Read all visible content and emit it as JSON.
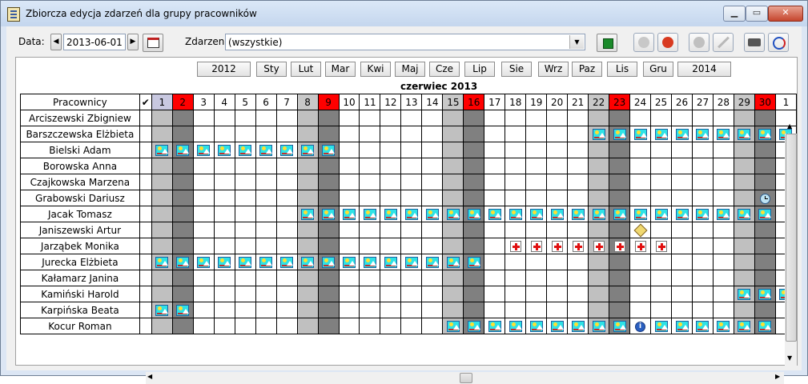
{
  "window": {
    "title": "Zbiorcza edycja zdarzeń dla grupy pracowników"
  },
  "toolbar": {
    "date_label": "Data:",
    "date_value": "2013-06-01",
    "event_label": "Zdarzenie:",
    "event_value": "(wszystkie)"
  },
  "months_nav": {
    "prev_year": "2012",
    "months": [
      "Sty",
      "Lut",
      "Mar",
      "Kwi",
      "Maj",
      "Cze",
      "Lip",
      "Sie",
      "Wrz",
      "Paz",
      "Lis",
      "Gru"
    ],
    "next_year": "2014"
  },
  "calendar": {
    "month_title": "czerwiec 2013",
    "name_header": "Pracownicy",
    "check_header": "✔",
    "days": [
      "1",
      "2",
      "3",
      "4",
      "5",
      "6",
      "7",
      "8",
      "9",
      "10",
      "11",
      "12",
      "13",
      "14",
      "15",
      "16",
      "17",
      "18",
      "19",
      "20",
      "21",
      "22",
      "23",
      "24",
      "25",
      "26",
      "27",
      "28",
      "29",
      "30",
      "1"
    ],
    "day_kinds": [
      "first",
      "hol",
      "",
      "",
      "",
      "",
      "",
      "we1",
      "hol",
      "",
      "",
      "",
      "",
      "",
      "we1",
      "hol",
      "",
      "",
      "",
      "",
      "",
      "we1",
      "hol",
      "",
      "",
      "",
      "",
      "",
      "we1",
      "hol",
      ""
    ],
    "col_kinds": [
      "we1",
      "we2",
      "",
      "",
      "",
      "",
      "",
      "we1",
      "we2",
      "",
      "",
      "",
      "",
      "",
      "we1",
      "we2",
      "",
      "",
      "",
      "",
      "",
      "we1",
      "we2",
      "",
      "",
      "",
      "",
      "",
      "we1",
      "we2",
      ""
    ],
    "employees": [
      {
        "name": "Arciszewski Zbigniew",
        "events": {}
      },
      {
        "name": "Barszczewska Elżbieta",
        "events": {
          "22": "vac",
          "23": "vac",
          "24": "vac",
          "25": "vac",
          "26": "vac",
          "27": "vac",
          "28": "vac",
          "29": "vac",
          "30": "vac",
          "31": "vac"
        }
      },
      {
        "name": "Bielski Adam",
        "events": {
          "1": "vac",
          "2": "vac",
          "3": "vac",
          "4": "vac",
          "5": "vac",
          "6": "vac",
          "7": "vac",
          "8": "vac",
          "9": "vac"
        }
      },
      {
        "name": "Borowska Anna",
        "events": {}
      },
      {
        "name": "Czajkowska Marzena",
        "events": {}
      },
      {
        "name": "Grabowski Dariusz",
        "events": {
          "30": "clock"
        }
      },
      {
        "name": "Jacak Tomasz",
        "events": {
          "8": "vac",
          "9": "vac",
          "10": "vac",
          "11": "vac",
          "12": "vac",
          "13": "vac",
          "14": "vac",
          "15": "vac",
          "16": "vac",
          "17": "vac",
          "18": "vac",
          "19": "vac",
          "20": "vac",
          "21": "vac",
          "22": "vac",
          "23": "vac",
          "24": "vac",
          "25": "vac",
          "26": "vac",
          "27": "vac",
          "28": "vac",
          "29": "vac",
          "30": "vac"
        }
      },
      {
        "name": "Janiszewski Artur",
        "events": {
          "24": "tag"
        }
      },
      {
        "name": "Jarząbek Monika",
        "events": {
          "18": "sick",
          "19": "sick",
          "20": "sick",
          "21": "sick",
          "22": "sick",
          "23": "sick",
          "24": "sick",
          "25": "sick"
        }
      },
      {
        "name": "Jurecka Elżbieta",
        "events": {
          "1": "vac",
          "2": "vac",
          "3": "vac",
          "4": "vac",
          "5": "vac",
          "6": "vac",
          "7": "vac",
          "8": "vac",
          "9": "vac",
          "10": "vac",
          "11": "vac",
          "12": "vac",
          "13": "vac",
          "14": "vac",
          "15": "vac",
          "16": "vac"
        }
      },
      {
        "name": "Kałamarz Janina",
        "events": {}
      },
      {
        "name": "Kamiński Harold",
        "events": {
          "29": "vac",
          "30": "vac",
          "31": "vac"
        }
      },
      {
        "name": "Karpińska Beata",
        "events": {
          "1": "vac",
          "2": "vac"
        }
      },
      {
        "name": "Kocur Roman",
        "events": {
          "15": "vac",
          "16": "vac",
          "17": "vac",
          "18": "vac",
          "19": "vac",
          "20": "vac",
          "21": "vac",
          "22": "vac",
          "23": "vac",
          "24": "info",
          "25": "vac",
          "26": "vac",
          "27": "vac",
          "28": "vac",
          "29": "vac",
          "30": "vac"
        }
      }
    ]
  },
  "icons": {
    "vac": "vacation-icon",
    "sick": "sick-leave-icon",
    "clock": "clock-icon",
    "tag": "tag-icon",
    "info": "info-icon"
  },
  "colors": {
    "holiday": "#ff0000",
    "weekend_sat": "#c0c0c0",
    "weekend_sun": "#808080"
  }
}
